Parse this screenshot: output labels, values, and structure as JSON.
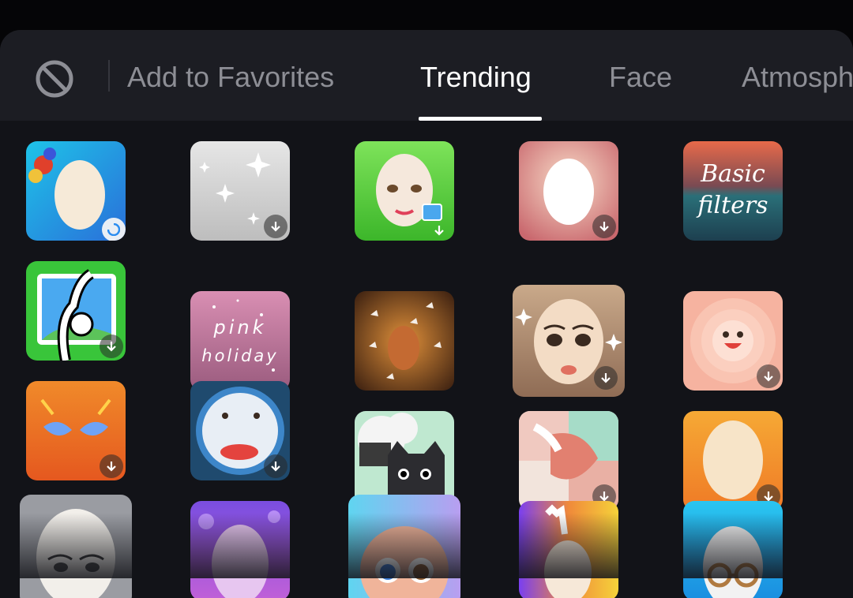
{
  "tabs": {
    "favorites": "Add to Favorites",
    "trending": "Trending",
    "face": "Face",
    "atmosphere": "Atmosph"
  },
  "active_tab": "Trending",
  "effects": {
    "pink_holiday": {
      "line1": "pink",
      "line2": "holiday"
    },
    "basic_filters": {
      "line1": "Basic",
      "line2": "filters"
    }
  },
  "colors": {
    "background": "#121318",
    "tab_bar": "#1c1d23",
    "tab_inactive": "#8d8e95",
    "tab_active": "#ffffff"
  },
  "icons": {
    "none": "no-effect-icon",
    "download": "download-icon",
    "loading": "loading-spinner-icon"
  }
}
